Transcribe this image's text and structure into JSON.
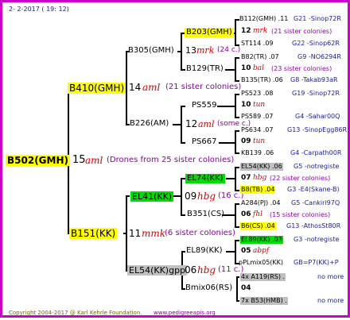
{
  "header": {
    "date": "2-  2-2017 ( 19: 12)"
  },
  "footer": {
    "copyright": "Copyright 2004-2017 @ Karl Kehrle Foundation.",
    "site": "www.pedigreeapis.org"
  },
  "root": {
    "name": "B502(GMH)",
    "num": "15",
    "type": "aml",
    "note": "(Drones from 25 sister colonies)"
  },
  "g1": [
    {
      "name": "B410(GMH)",
      "num": "14",
      "type": "aml",
      "note": "(21 sister colonies)"
    },
    {
      "name": "B151(KK)",
      "num": "11",
      "type": "mmk",
      "note": "(6 sister colonies)"
    }
  ],
  "g2": [
    {
      "name": "B305(GMH)"
    },
    {
      "name": "B226(AM)",
      "num": "12",
      "type": "aml",
      "note": "(some c.)"
    },
    {
      "name": "EL41(KK)",
      "num": "09",
      "type": "hbg",
      "note": "(16 c.)"
    },
    {
      "name": "EL54(KK)gpp",
      "num": "06",
      "type": "hbg",
      "note": "(11 c.)"
    }
  ],
  "g3": [
    {
      "name": "B203(GMH)",
      "num": "13",
      "type": "mrk",
      "note": "(24 c.)"
    },
    {
      "name": "B129(TR)"
    },
    {
      "name": "PS559"
    },
    {
      "name": "PS667"
    },
    {
      "name": "EL74(KK)"
    },
    {
      "name": "B351(CS)"
    },
    {
      "name": "EL89(KK)"
    },
    {
      "name": "Bmix06(RS)",
      "num": "04"
    }
  ],
  "g4": [
    {
      "left": "B112(GMH) .11",
      "right": "G21 -Sinop72R"
    },
    {
      "num": "12",
      "type": "mrk",
      "note": "(21 sister colonies)"
    },
    {
      "left": "ST114 .09",
      "right": "G22 -Sinop62R"
    },
    {
      "left": "B82(TR) .07",
      "right": "G9 -NO6294R"
    },
    {
      "num": "10",
      "type": "bal",
      "note": "(23 sister colonies)"
    },
    {
      "left": "B135(TR) .06",
      "right": "G8 -Takab93aR"
    },
    {
      "left": "PS523 .08",
      "right": "G19 -Sinop72R"
    },
    {
      "num": "10",
      "type": "tun",
      "note": ""
    },
    {
      "left": "PS589 .07",
      "right": "G4 -Sahar00Q"
    },
    {
      "left": "PS634 .07",
      "right": "G13 -SinopEgg86R"
    },
    {
      "num": "09",
      "type": "tun",
      "note": ""
    },
    {
      "left": "KB139 .06",
      "right": "G4 -Carpath00R"
    },
    {
      "left": "EL54(KK) .06",
      "right": "G5 -notregiste"
    },
    {
      "num": "07",
      "type": "hbg",
      "note": "(22 sister colonies)"
    },
    {
      "left": "B8(TB) .04",
      "right": "G3 -E4(Skane-B)"
    },
    {
      "left": "A284(PJ) .04",
      "right": "G5 -Cankiri97Q"
    },
    {
      "num": "06",
      "type": "fhl",
      "note": "(15 sister colonies)"
    },
    {
      "left": "B6(CS) .04",
      "right": "G13 -AthosSt80R"
    },
    {
      "left": "EL89(KK) .03",
      "right": "G3 -notregiste"
    },
    {
      "num": "05",
      "type": "abpf",
      "note": ""
    },
    {
      "left": "pPLmix05(KK)",
      "right": "GB=P7(KK)+P"
    },
    {
      "left": "4x A119(RS) .",
      "right": "no more"
    },
    {
      "num": "04",
      "type": "",
      "note": ""
    },
    {
      "left": "7x B53(HMB) .",
      "right": "no more"
    }
  ]
}
